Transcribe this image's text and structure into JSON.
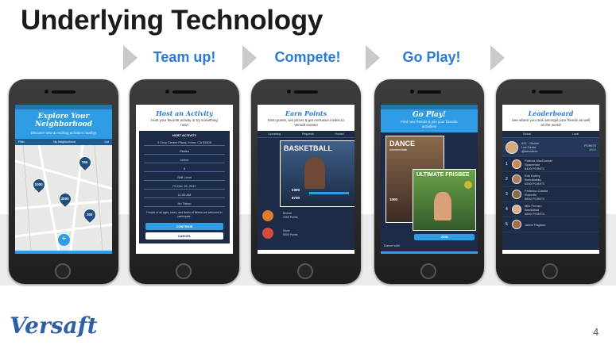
{
  "slide": {
    "title": "Underlying Technology",
    "steps": [
      "Team up!",
      "Compete!",
      "Go Play!"
    ],
    "page_number": "4",
    "logo_text": "Versaft"
  },
  "phones": {
    "explore": {
      "heading": "Explore Your Neighborhood",
      "subtitle": "Discover new & exciting activities nearby!",
      "nav_left": "Filter",
      "nav_center": "My Neighborhood",
      "nav_right": "List",
      "pins": [
        "250",
        "1000",
        "2000",
        "250"
      ],
      "fab": "+"
    },
    "host": {
      "heading": "Host an Activity",
      "subtitle": "Host your favorite activity or try something new!",
      "form_title": "HOST ACTIVITY",
      "fields": [
        "4 Civic Center Plaza, Irvine, CA 92606",
        "Pilates",
        "Indoor",
        "5",
        "Skill Level",
        "Fri Dec 15, 2017",
        "11:00 AM",
        "No Taboo"
      ],
      "note": "People of all ages, sizes, and levels of fitness are welcome to participate.",
      "continue_label": "CONTINUE",
      "cancel_label": "CANCEL"
    },
    "earn": {
      "heading": "Earn Points",
      "subtitle": "Earn points, win prizes & get exclusive invites to Versaft events!",
      "tabs": [
        "Upcoming",
        "Requests",
        "Hosted"
      ],
      "card_title": "BASKETBALL",
      "points_a": "2300",
      "points_b": "6700",
      "tiers": [
        "Bronze",
        "Silver"
      ],
      "tier_pts": [
        "2000 Points",
        "6000 Points"
      ]
    },
    "play": {
      "heading": "Go Play!",
      "subtitle": "Find new friends & join your favorite activities!",
      "card1_title": "DANCE",
      "card1_level": "Intermediate",
      "card2_title": "ULTIMATE FRISBEE",
      "points": "1000",
      "join_label": "JOIN",
      "footer_text": "Dance with"
    },
    "leaderboard": {
      "heading": "Leaderboard",
      "subtitle": "See where you rank amongst your friends as well as the world!",
      "tabs": [
        "Global",
        "Local"
      ],
      "top_rank": "#21 · Global",
      "top_name": "Los Gente",
      "top_handle": "@lemailxxx",
      "top_pts_label": "POINTS",
      "top_pts": "4600",
      "rows": [
        {
          "rank": "1",
          "name": "Patricia MacDonald",
          "sub": "Spaceman",
          "pts": "6400 POINTS"
        },
        {
          "rank": "2",
          "name": "Erik Dobby",
          "sub": "Bretoklabby",
          "pts": "6200 POINTS"
        },
        {
          "rank": "3",
          "name": "Federico Camila",
          "sub": "Robertis",
          "pts": "5800 POINTS"
        },
        {
          "rank": "4",
          "name": "Milo Ferraro",
          "sub": "Bandabad",
          "pts": "5600 POINTS"
        },
        {
          "rank": "5",
          "name": "Jaime Pagliaro",
          "sub": "",
          "pts": ""
        }
      ]
    }
  },
  "colors": {
    "accent_blue": "#2b7bd6",
    "map_blue": "#2e9de6",
    "dark_navy": "#1d2b46",
    "logo_blue": "#2f5fa5"
  }
}
